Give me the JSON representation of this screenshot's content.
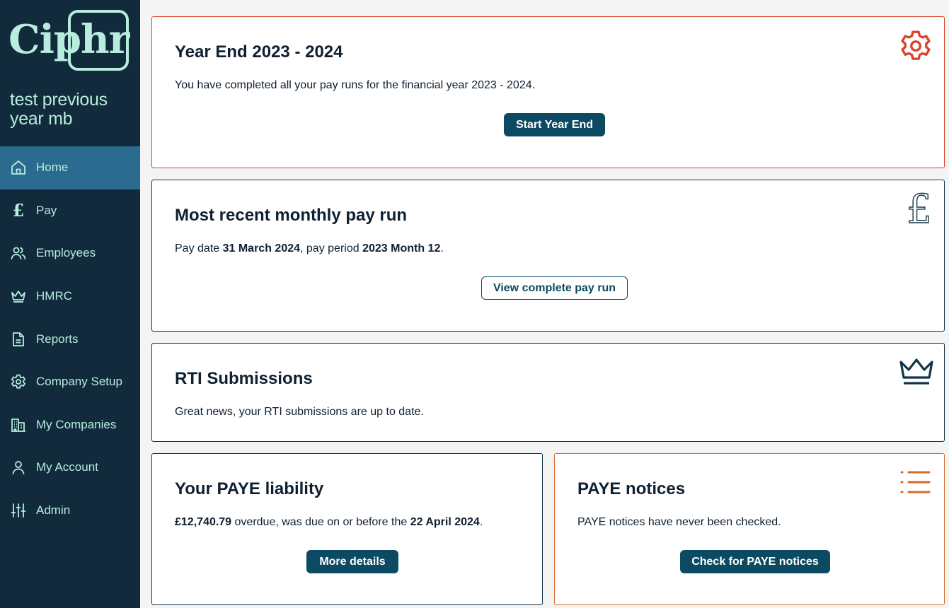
{
  "brand": {
    "logo_text": "Ciphr"
  },
  "company": {
    "name": "test previous year mb"
  },
  "nav": [
    {
      "label": "Home",
      "icon": "home-icon",
      "active": true
    },
    {
      "label": "Pay",
      "icon": "pound-icon"
    },
    {
      "label": "Employees",
      "icon": "users-icon"
    },
    {
      "label": "HMRC",
      "icon": "crown-icon"
    },
    {
      "label": "Reports",
      "icon": "document-icon"
    },
    {
      "label": "Company Setup",
      "icon": "gear-icon"
    },
    {
      "label": "My Companies",
      "icon": "building-icon"
    },
    {
      "label": "My Account",
      "icon": "user-icon"
    },
    {
      "label": "Admin",
      "icon": "sliders-icon"
    }
  ],
  "year_end": {
    "title": "Year End 2023 - 2024",
    "text": "You have completed all your pay runs for the financial year 2023 - 2024.",
    "button": "Start Year End",
    "icon": "gear-icon",
    "accent": "#d9412a"
  },
  "pay_run": {
    "title": "Most recent monthly pay run",
    "text_prefix": "Pay date ",
    "pay_date": "31 March 2024",
    "text_mid": ", pay period ",
    "period": "2023 Month 12",
    "text_suffix": ".",
    "button": "View complete pay run",
    "icon": "pound-icon"
  },
  "rti": {
    "title": "RTI Submissions",
    "text": "Great news, your RTI submissions are up to date.",
    "icon": "crown-icon"
  },
  "paye_liability": {
    "title": "Your PAYE liability",
    "amount": "£12,740.79",
    "text_mid": " overdue, was due on or before the ",
    "due_date": "22 April 2024",
    "text_suffix": ".",
    "button": "More details"
  },
  "paye_notices": {
    "title": "PAYE notices",
    "text": "PAYE notices have never been checked.",
    "button": "Check for PAYE notices",
    "icon": "list-icon",
    "accent": "#d9692a"
  },
  "colors": {
    "sidebar": "#112b3c",
    "active_nav": "#2b6b90",
    "mint": "#b7ecde",
    "primary": "#0c4a63"
  }
}
